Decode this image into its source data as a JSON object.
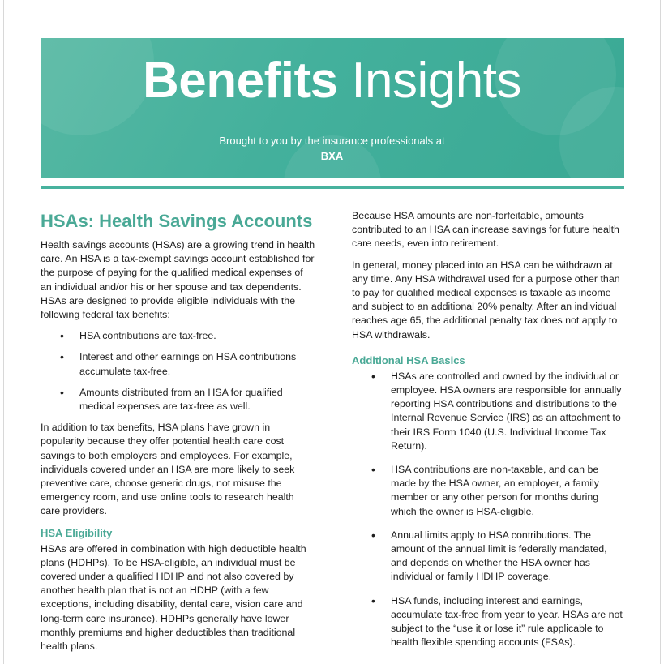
{
  "banner": {
    "title_bold": "Benefits",
    "title_light": "Insights",
    "subtitle": "Brought to you by the insurance professionals at",
    "brand": "BXA"
  },
  "left": {
    "heading": "HSAs: Health Savings Accounts",
    "intro": "Health savings accounts (HSAs) are a growing trend in health care. An HSA is a tax-exempt savings account established for the purpose of paying for the qualified medical expenses of an individual and/or his or her spouse and tax dependents. HSAs are designed to provide eligible individuals with the following federal tax benefits:",
    "bullets": [
      "HSA contributions are tax-free.",
      "Interest and other earnings on HSA contributions accumulate tax-free.",
      "Amounts distributed from an HSA for qualified medical expenses are tax-free as well."
    ],
    "para2": "In addition to tax benefits, HSA plans have grown in popularity because they offer potential health care cost savings to both employers and employees. For example, individuals covered under an HSA are more likely to seek preventive care, choose generic drugs, not misuse the emergency room, and use online tools to research health care providers.",
    "eligibility_heading": "HSA Eligibility",
    "eligibility_text": "HSAs are offered in combination with high deductible health plans (HDHPs). To be HSA-eligible, an individual must be covered under a qualified HDHP and not also covered by another health plan that is not an HDHP (with a few exceptions, including disability, dental care, vision care and long-term care insurance). HDHPs generally have lower monthly premiums and higher deductibles than traditional health plans."
  },
  "right": {
    "para1": "Because HSA amounts are non-forfeitable, amounts contributed to an HSA can increase savings for future health care needs, even into retirement.",
    "para2": "In general, money placed into an HSA can be withdrawn at any time. Any HSA withdrawal used for a purpose other than to pay for qualified medical expenses is taxable as income and subject to an additional 20% penalty. After an individual reaches age 65, the additional penalty tax does not apply to HSA withdrawals.",
    "basics_heading": "Additional HSA Basics",
    "bullets": [
      "HSAs are controlled and owned by the individual or employee. HSA owners are responsible for annually reporting HSA contributions and distributions to the Internal Revenue Service (IRS) as an attachment to their IRS Form 1040 (U.S. Individual Income Tax Return).",
      "HSA contributions are non-taxable, and can be made by the HSA owner, an employer, a family member or any other person for months during which the owner is HSA-eligible.",
      "Annual limits apply to HSA contributions. The amount of the annual limit is federally mandated, and depends on whether the HSA owner has individual or family HDHP coverage.",
      "HSA funds, including interest and earnings, accumulate tax-free from year to year. HSAs are not subject to the “use it or lose it” rule applicable to health flexible spending accounts (FSAs)."
    ]
  }
}
